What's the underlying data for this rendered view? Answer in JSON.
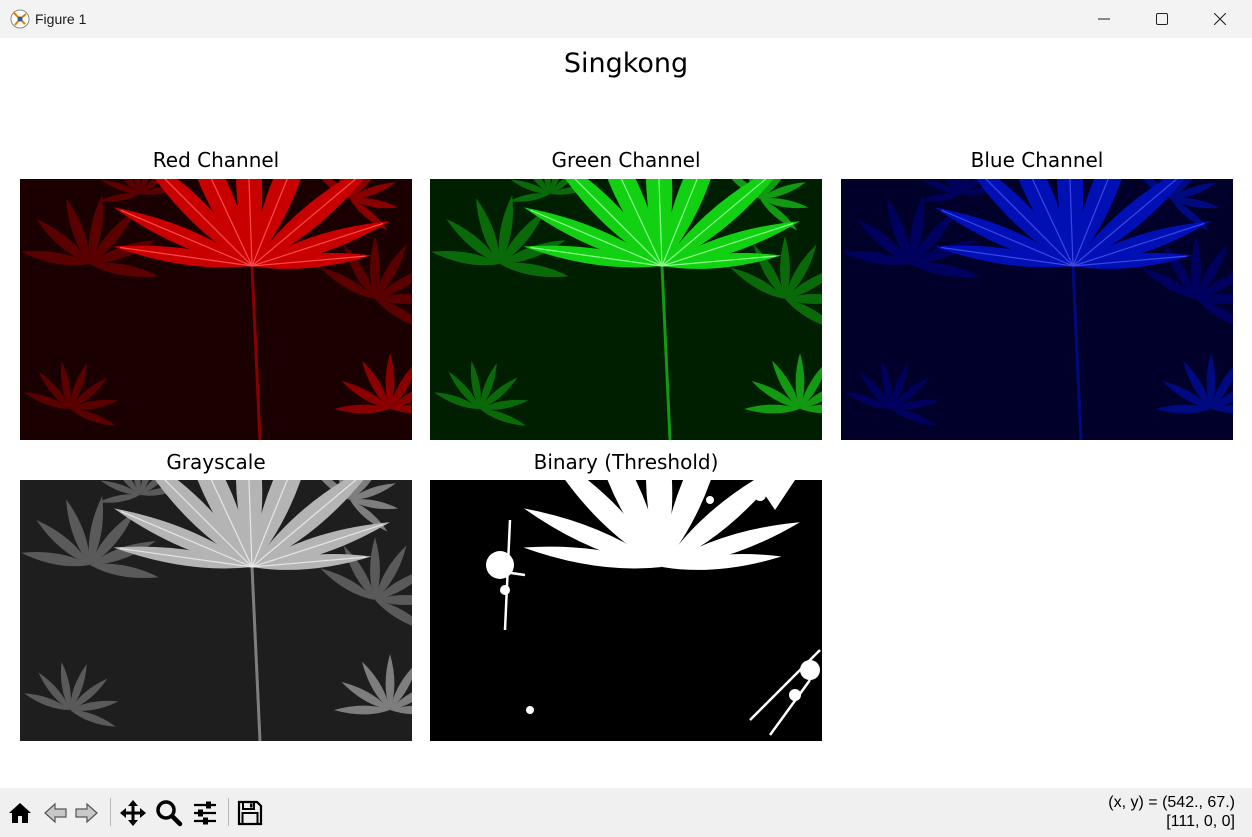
{
  "window": {
    "title": "Figure 1"
  },
  "figure": {
    "suptitle": "Singkong",
    "panels": [
      {
        "title": "Red Channel"
      },
      {
        "title": "Green Channel"
      },
      {
        "title": "Blue Channel"
      },
      {
        "title": "Grayscale"
      },
      {
        "title": "Binary (Threshold)"
      }
    ]
  },
  "toolbar": {
    "buttons": [
      "home-icon",
      "back-icon",
      "forward-icon",
      "pan-icon",
      "zoom-icon",
      "configure-subplots-icon",
      "save-icon"
    ]
  },
  "status": {
    "coords": "(x, y) = (542., 67.)",
    "pixel": "[111, 0, 0]"
  },
  "colors": {
    "red_channel": "#d40000",
    "green_channel": "#00c800",
    "blue_channel": "#0008c0",
    "grayscale": "#b4b4b4",
    "binary": "#ffffff"
  }
}
